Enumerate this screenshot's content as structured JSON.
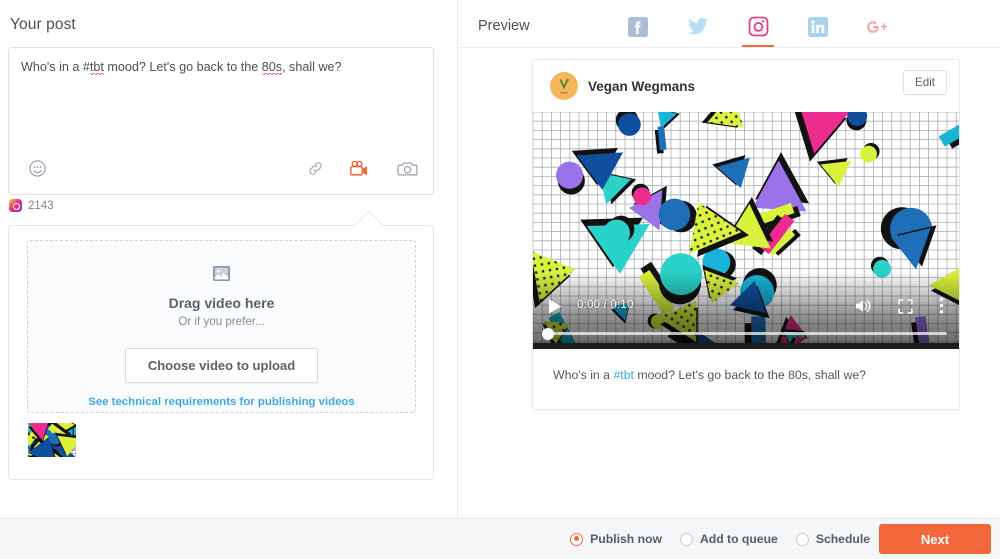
{
  "compose": {
    "title": "Your post",
    "text_parts": [
      {
        "t": "Who's in a #",
        "sp": false
      },
      {
        "t": "tbt",
        "sp": true
      },
      {
        "t": " mood? Let's go back to the ",
        "sp": false
      },
      {
        "t": "80s",
        "sp": true
      },
      {
        "t": ", shall we?",
        "sp": false
      }
    ],
    "full_text": "Who's in a #tbt mood? Let's go back to the 80s, shall we?",
    "char_count": "2143",
    "network_icon": "instagram-icon",
    "toolbar": {
      "emoji_icon": "emoji-smiley-icon",
      "link_icon": "link-chain-icon",
      "video_icon": "video-camera-icon",
      "photo_icon": "camera-icon"
    }
  },
  "upload": {
    "image_icon": "image-placeholder-icon",
    "drag_title": "Drag video here",
    "drag_sub": "Or if you prefer...",
    "choose_button": "Choose video to upload",
    "tech_link": "See technical requirements for publishing videos",
    "thumbnail_name": "video-thumbnail"
  },
  "preview": {
    "title": "Preview",
    "tabs": [
      {
        "name": "facebook",
        "label": "f",
        "color": "#aebdd6",
        "active": false
      },
      {
        "name": "twitter",
        "label": "twitter-bird",
        "color": "#b9ddf5",
        "active": false
      },
      {
        "name": "instagram",
        "label": "instagram-camera",
        "color": "#e0427f",
        "active": true
      },
      {
        "name": "linkedin",
        "label": "in",
        "color": "#a6d4ec",
        "active": false
      },
      {
        "name": "googleplus",
        "label": "G+",
        "color": "#f5a9a4",
        "active": false
      }
    ],
    "active_tab": "instagram",
    "accent_color": "#f2693c",
    "card": {
      "brand_name": "Vegan Wegmans",
      "avatar_initial": "V",
      "avatar_color": "#f4b75c",
      "edit_label": "Edit",
      "caption_prefix": "Who's in a ",
      "caption_hashtag": "#tbt",
      "caption_suffix": " mood? Let's go back to the 80s, shall we?",
      "video": {
        "current_time": "0:00",
        "duration": "0:10",
        "time_display": "0:00 / 0:10",
        "play_icon": "play-icon",
        "volume_icon": "volume-on-icon",
        "fullscreen_icon": "fullscreen-icon",
        "menu_icon": "kebab-menu-icon",
        "progress_percent": 0
      }
    }
  },
  "bottom": {
    "options": [
      {
        "label": "Publish now",
        "selected": true
      },
      {
        "label": "Add to queue",
        "selected": false
      },
      {
        "label": "Schedule",
        "selected": false
      }
    ],
    "next_label": "Next"
  }
}
